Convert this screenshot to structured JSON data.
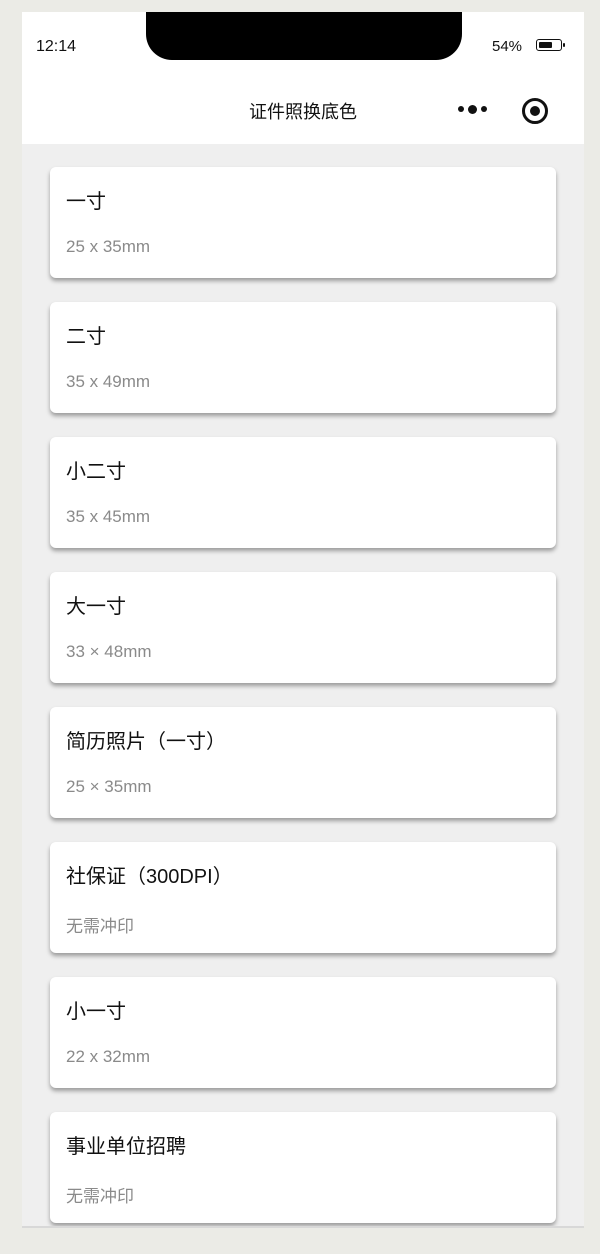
{
  "status_bar": {
    "time": "12:14",
    "battery_percent": "54%",
    "battery_level": 0.54
  },
  "nav": {
    "title": "证件照换底色",
    "more_icon": "more-dots-icon",
    "close_icon": "target-circle-icon"
  },
  "items": [
    {
      "title": "一寸",
      "subtitle": "25 x 35mm"
    },
    {
      "title": "二寸",
      "subtitle": "35 x 49mm"
    },
    {
      "title": "小二寸",
      "subtitle": "35 x 45mm"
    },
    {
      "title": "大一寸",
      "subtitle": "33 × 48mm"
    },
    {
      "title": "简历照片（一寸）",
      "subtitle": "25 × 35mm"
    },
    {
      "title": "社保证（300DPI）",
      "subtitle": "无需冲印"
    },
    {
      "title": "小一寸",
      "subtitle": "22 x 32mm"
    },
    {
      "title": "事业单位招聘",
      "subtitle": "无需冲印"
    }
  ]
}
